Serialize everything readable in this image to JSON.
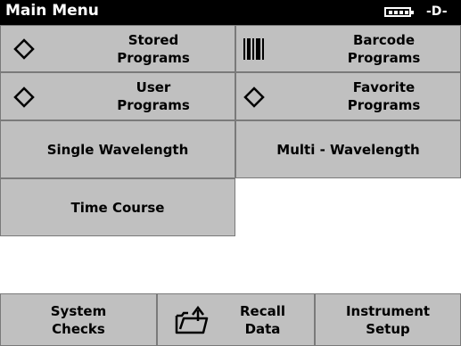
{
  "header": {
    "title": "Main Menu",
    "battery_icon": "battery-icon",
    "power_icon": "power-plug-icon"
  },
  "menu": {
    "stored_programs": "Stored\nPrograms",
    "barcode_programs": "Barcode\nPrograms",
    "user_programs": "User\nPrograms",
    "favorite_programs": "Favorite\nPrograms",
    "single_wavelength": "Single Wavelength",
    "multi_wavelength": "Multi - Wavelength",
    "time_course": "Time Course"
  },
  "footer": {
    "system_checks": "System\nChecks",
    "recall_data": "Recall\nData",
    "instrument_setup": "Instrument\nSetup"
  },
  "colors": {
    "button_bg": "#c0c0c0",
    "titlebar_bg": "#000000",
    "border": "#7a7a7a"
  }
}
